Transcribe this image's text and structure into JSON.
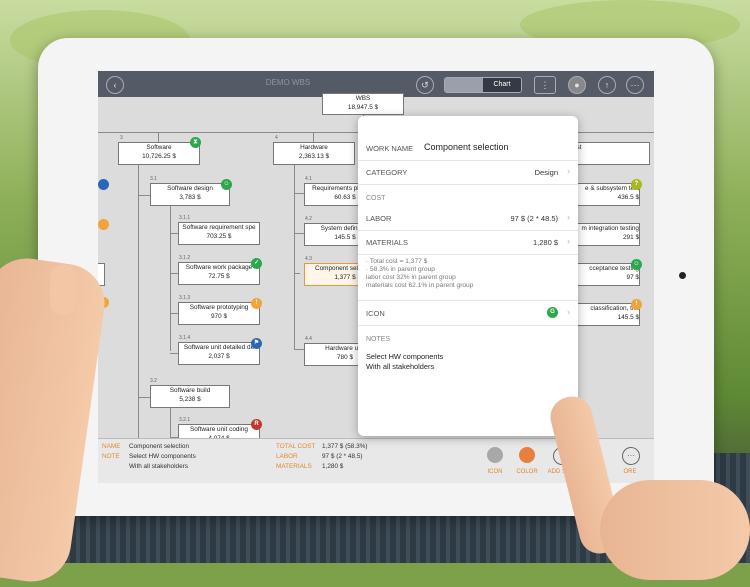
{
  "app": {
    "title": "DEMO WBS",
    "view_modes": [
      "Outline",
      "Chart"
    ],
    "active_view": "Chart"
  },
  "icons": {
    "back": "chevron-left-icon",
    "undo": "undo-icon",
    "layout": "tree-layout-icon",
    "avatar": "user-avatar-icon",
    "share": "share-icon",
    "more": "more-icon"
  },
  "colors": {
    "accent": "#e08a2d",
    "green": "#2aa84a",
    "orange": "#f2a33c",
    "red": "#c0392b",
    "blue": "#2b67b8",
    "olive": "#a8b81f"
  },
  "tree": {
    "root": {
      "name": "WBS",
      "cost": "18,947.5 $"
    },
    "software": {
      "num": "3",
      "name": "Software",
      "cost": "10,726.25 $"
    },
    "hardware": {
      "num": "4",
      "name": "Hardware",
      "cost": "2,363.13 $"
    },
    "sw_design": {
      "num": "3.1",
      "name": "Software design",
      "cost": "3,783 $"
    },
    "sw_req": {
      "num": "3.1.1",
      "name": "Software requirement spe",
      "cost": "703.25 $"
    },
    "sw_pkg": {
      "num": "3.1.2",
      "name": "Software work package",
      "cost": "72.75 $"
    },
    "sw_proto": {
      "num": "3.1.3",
      "name": "Software prototyping",
      "cost": "970 $"
    },
    "sw_detail": {
      "num": "3.1.4",
      "name": "Software unit detailed de",
      "cost": "2,037 $"
    },
    "sw_build": {
      "num": "3.2",
      "name": "Software build",
      "cost": "5,238 $"
    },
    "sw_coding": {
      "num": "3.2.1",
      "name": "Software unit coding",
      "cost": "4,074 $"
    },
    "hw_req": {
      "num": "4.1",
      "name": "Requirements planning",
      "cost": "60.63 $"
    },
    "hw_sys": {
      "num": "4.2",
      "name": "System definition",
      "cost": "145.5 $"
    },
    "hw_comp": {
      "num": "4.3",
      "name": "Component selection",
      "cost": "1,377 $"
    },
    "hw_unit": {
      "num": "4.4",
      "name": "Hardware unit",
      "cost": "780 $"
    },
    "r_test": {
      "name": "est",
      "cost": ""
    },
    "r_subsys": {
      "name": "e & subsystem test",
      "cost": "436.5 $"
    },
    "r_integ": {
      "name": "m integration testing",
      "cost": "291 $"
    },
    "r_accept": {
      "name": "cceptance testing",
      "cost": "97 $"
    },
    "r_class": {
      "name": "classification, trai",
      "cost": "145.5 $"
    }
  },
  "popover": {
    "work_name_label": "WORK NAME",
    "work_name": "Component selection",
    "category_label": "CATEGORY",
    "category": "Design",
    "cost_section": "COST",
    "labor_label": "LABOR",
    "labor": "97 $ (2 * 48.5)",
    "materials_label": "MATERIALS",
    "materials": "1,280 $",
    "summary": [
      "· Total cost = 1,377 $",
      "· 58.3% in parent group",
      "  labor cost 32% in parent group",
      "  materials cost 62.1% in parent group"
    ],
    "icon_label": "ICON",
    "icon_letter": "G",
    "notes_section": "NOTES",
    "notes": [
      "Select HW components",
      "With all stakeholders"
    ]
  },
  "bottom": {
    "name_label": "NAME",
    "name": "Component selection",
    "note_label": "NOTE",
    "note1": "Select HW components",
    "note2": "With all stakeholders",
    "total_label": "TOTAL COST",
    "total": "1,377 $ (58.3%)",
    "labor_label": "LABOR",
    "labor": "97 $ (2 * 48.5)",
    "materials_label": "MATERIALS",
    "materials": "1,280 $",
    "btn_icon": "ICON",
    "btn_color": "COLOR",
    "btn_addsub": "ADD SUB",
    "btn_more": "ORE"
  }
}
